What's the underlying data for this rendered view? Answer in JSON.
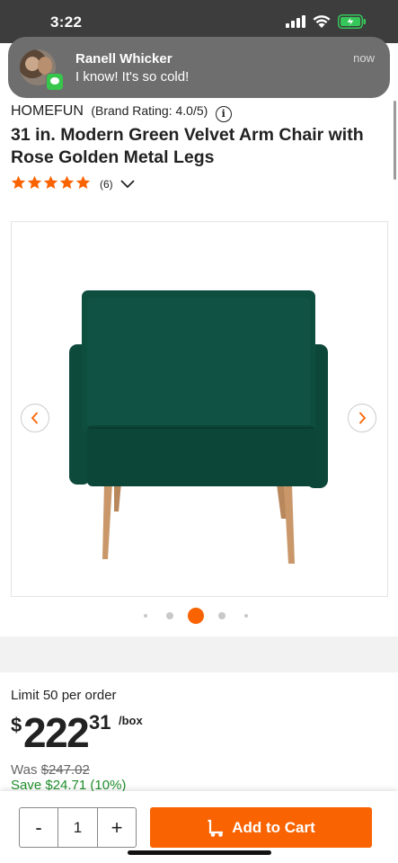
{
  "status_bar": {
    "time": "3:22",
    "icons": [
      "cellular-signal-icon",
      "wifi-icon",
      "battery-charging-icon"
    ],
    "battery_color": "#35c759"
  },
  "notification": {
    "sender": "Ranell Whicker",
    "message": "I know! It's so cold!",
    "time": "now",
    "app_icon": "messages-icon"
  },
  "product": {
    "brand": "HOMEFUN",
    "brand_rating": "(Brand Rating: 4.0/5)",
    "title": "31 in. Modern Green Velvet Arm Chair with Rose Golden Metal Legs",
    "stars": 5,
    "review_count": "(6)",
    "star_color": "#f96302"
  },
  "gallery": {
    "image_subject": "green-velvet-arm-chair",
    "dot_count": 5,
    "active_dot": 2,
    "accent": "#f96302"
  },
  "pricing": {
    "limit": "Limit 50 per order",
    "currency": "$",
    "dollars": "222",
    "cents": "31",
    "unit": "/box",
    "was_label": "Was",
    "was_price": "$247.02",
    "save": "Save $24.71 (10%)"
  },
  "cart": {
    "minus": "-",
    "quantity": "1",
    "plus": "+",
    "add_to_cart": "Add to Cart",
    "button_color": "#f96302"
  }
}
